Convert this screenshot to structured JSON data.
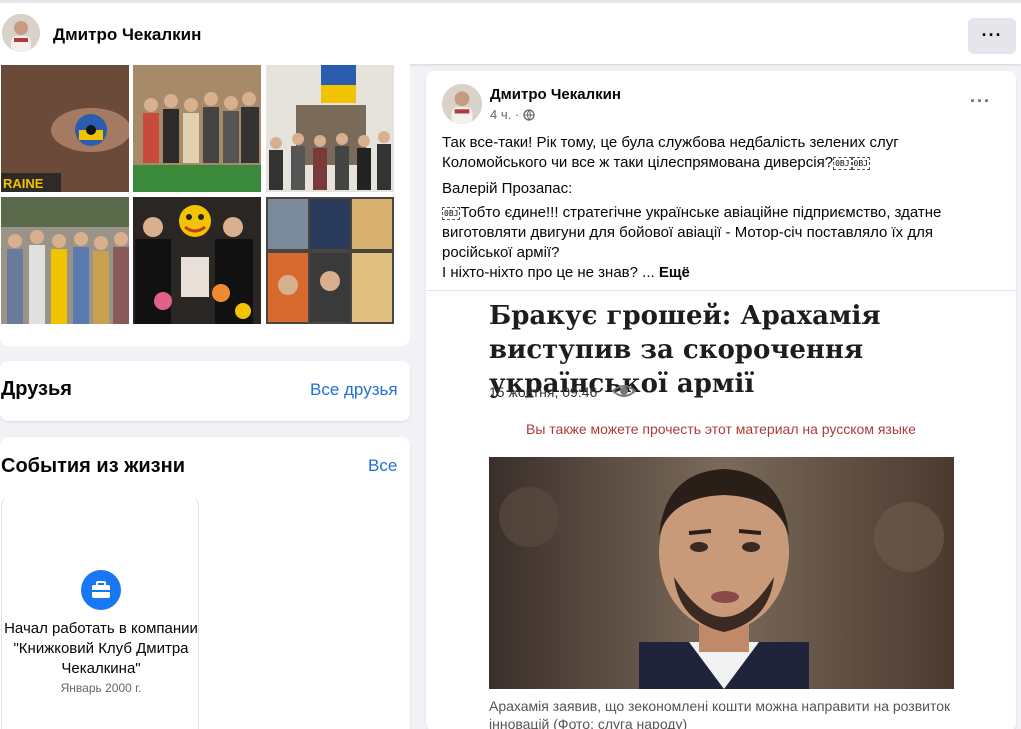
{
  "profile": {
    "name": "Дмитро Чекалкин",
    "more_label": "···"
  },
  "photos": {
    "tiles": [
      {
        "caption": "RAINE"
      },
      {
        "caption": ""
      },
      {
        "caption": ""
      },
      {
        "caption": ""
      },
      {
        "caption": ""
      },
      {
        "caption": ""
      }
    ]
  },
  "friends_card": {
    "title": "Друзья",
    "link": "Все друзья"
  },
  "life_events_card": {
    "title": "События из жизни",
    "link": "Все",
    "event": {
      "icon": "briefcase-icon",
      "text": "Начал работать в компании \"Книжковий Клуб Дмитра Чекалкина\"",
      "date": "Январь 2000 г."
    }
  },
  "post": {
    "author": "Дмитро Чекалкин",
    "time": "4 ч.",
    "separator": "·",
    "privacy_icon": "globe-icon",
    "more_label": "···",
    "paragraph1": "Так все-таки! Рік тому, це була службова недбалість зелених слуг Коломойського чи все ж таки цілеспрямована диверсія?",
    "emoji_a": "0BJ",
    "emoji_b": "0BJ",
    "quote_author": "Валерій Прозапас:",
    "paragraph2": "Тобто єдине!!! стратегічне українське авіаційне підприємство, здатне виготовляти двигуни для бойової авіації - Мотор-січ поставляло їх для російської армії?",
    "paragraph3": "І ніхто-ніхто про це не знав? ...",
    "see_more": "Ещё"
  },
  "article": {
    "headline": "Бракує грошей: Арахамія виступив за скорочення української армії",
    "date": "15 жовтня, 09:46",
    "eye_icon": "eye-icon",
    "russian_notice": "Вы также можете прочесть этот материал на русском языке",
    "caption": "Арахамія заявив, що зекономлені кошти можна направити на розвиток інновацій (Фото: слуга народу)"
  },
  "colors": {
    "background": "#f0f2f5",
    "link": "#216fdb",
    "accent": "#1877f2",
    "notice": "#b03a3a"
  }
}
